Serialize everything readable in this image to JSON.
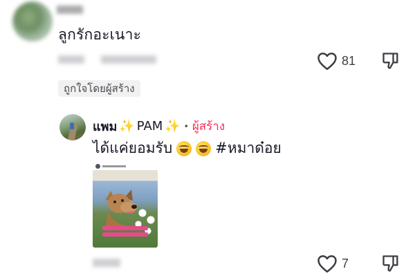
{
  "comments": [
    {
      "text": "ลูกรักอะเนาะ",
      "likes": "81",
      "liked_badge": "ถูกใจโดยผู้สร้าง"
    },
    {
      "author": "แพม",
      "author_suffix": "PAM",
      "creator_label": "ผู้สร้าง",
      "text_main": "ได้แค่ยอมรับ",
      "hashtag": "#หมาด๋อย",
      "likes": "7"
    }
  ],
  "icons": {
    "heart": "heart-outline-icon",
    "dislike": "thumbs-down-icon",
    "sparkle": "sparkles-emoji",
    "laugh": "rolling-on-floor-laughing-emoji"
  },
  "colors": {
    "creator": "#fe2c55",
    "text": "#161823",
    "muted": "#3d3d44"
  }
}
